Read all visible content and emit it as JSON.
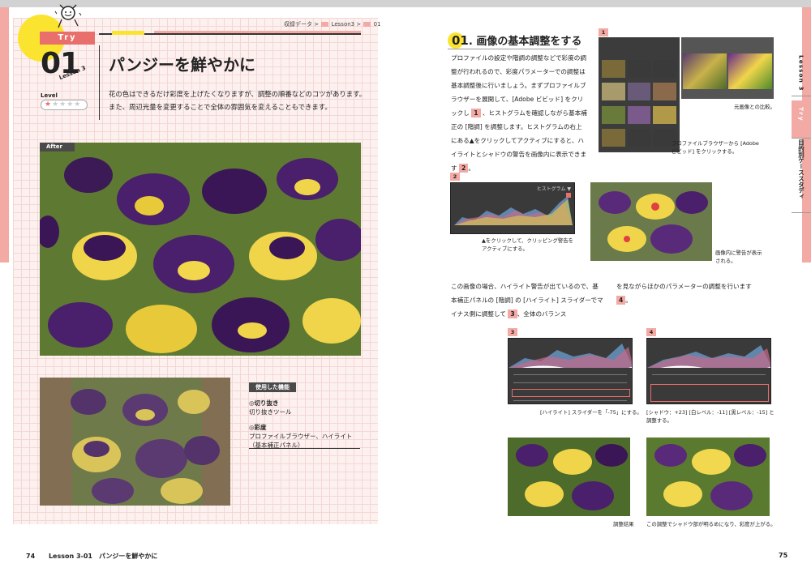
{
  "left_page": {
    "badge": "Try",
    "lesson_number": "01",
    "lesson_tag": "Lesson 3",
    "title": "パンジーを鮮やかに",
    "breadcrumb": {
      "part1": "収録データ >",
      "part2": "Lesson3 >",
      "part3": "01"
    },
    "level": {
      "label": "Level",
      "rating": 1,
      "max": 5,
      "stars_on": "★",
      "stars_off": "★★★★"
    },
    "intro": "花の色はできるだけ彩度を上げたくなりますが、調整の順番などのコツがあります。また、周辺光量を変更することで全体の雰囲気を変えることもできます。",
    "after_label": "After",
    "features": {
      "title": "使用した機能",
      "items": [
        {
          "name": "◎切り抜き",
          "detail": "切り抜きツール"
        },
        {
          "name": "◎彩度",
          "detail": "プロファイルブラウザー、ハイライト（基本補正パネル）"
        }
      ]
    },
    "footer": {
      "page": "74",
      "text": "Lesson 3-01　パンジーを鮮やかに"
    }
  },
  "right_page": {
    "step_number": "01",
    "step_title": ". 画像の基本調整をする",
    "body1_a": "プロファイルの設定や階調の調整などで彩度の調整が行われるので、彩度パラメーターでの調整は基本調整後に行いましょう。まずプロファイルブラウザーを展開して、[Adobe ビビッド] をクリックし",
    "ref1": "1",
    "body1_b": "、ヒストグラムを確認しながら基本補正の [階調] を調整します。ヒストグラムの右上にある▲をクリックしてアクティブにすると、ハイライトとシャドウの警告を画像内に表示できます",
    "ref2": "2",
    "body1_c": "。",
    "body2_a": "この画像の場合、ハイライト警告が出ているので、基本補正パネルの [階調] の [ハイライト] スライダーでマイナス側に調整して",
    "ref3": "3",
    "body2_b": "、全体のバランス",
    "body3_a": "を見ながらほかのパラメーターの調整を行います",
    "ref4": "4",
    "body3_b": "。",
    "figures": {
      "f1": "1",
      "f2": "2",
      "f3": "3",
      "f4": "4",
      "cap1a": "元画像との比較。",
      "cap1b": "プロファイルブラウザーから [Adobe ビビッド] をクリックする。",
      "histo_title": "ヒストグラム ▼",
      "cap2a": "▲をクリックして、クリッピング警告をアクティブにする。",
      "cap2b": "画像内に警告が表示される。",
      "cap3": "[ハイライト] スライダーを「-75」にする。",
      "cap4": "[シャドウ：+23] [白レベル：-11] [黒レベル：-15] と調整する。",
      "cap5": "調整結果",
      "cap6": "この調整でシャドウ部が明るめになり、彩度が上がる。"
    },
    "side_tabs": {
      "lesson": "Lesson 3",
      "try": "Try",
      "category": "目的別ケーススタディ"
    },
    "footer_page": "75"
  }
}
